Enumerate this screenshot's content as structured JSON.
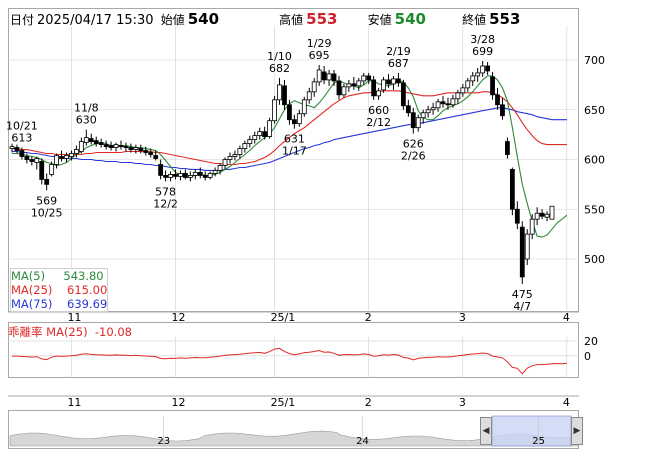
{
  "header": {
    "date_label": "日付",
    "date": "2025/04/17 15:30",
    "open_label": "始値",
    "open": "540",
    "high_label": "高値",
    "high": "553",
    "low_label": "安値",
    "low": "540",
    "close_label": "終値",
    "close": "553"
  },
  "legend": {
    "ma5_label": "MA(5)",
    "ma5_value": "543.80",
    "ma25_label": "MA(25)",
    "ma25_value": "615.00",
    "ma75_label": "MA(75)",
    "ma75_value": "639.69"
  },
  "oscillator": {
    "label": "乖離率 MA(25)",
    "value": "-10.08",
    "yticks": [
      "20",
      "0"
    ]
  },
  "colors": {
    "ma5": "#2e8b3a",
    "ma25": "#e02828",
    "ma75": "#2838d8",
    "candle": "#000000",
    "grid": "#d0d0d0",
    "nav_fill": "#c8d4f4"
  },
  "chart_data": {
    "type": "candlestick",
    "ylim": [
      450,
      720
    ],
    "yticks": [
      500,
      550,
      600,
      650,
      700
    ],
    "xticks": [
      {
        "label": "11",
        "index": 12
      },
      {
        "label": "12",
        "index": 33
      },
      {
        "label": "25/1",
        "index": 53
      },
      {
        "label": "2",
        "index": 72
      },
      {
        "label": "3",
        "index": 91
      },
      {
        "label": "4",
        "index": 112
      }
    ],
    "candles": [
      [
        611,
        616,
        607,
        613
      ],
      [
        612,
        615,
        606,
        609
      ],
      [
        609,
        612,
        600,
        603
      ],
      [
        603,
        606,
        596,
        600
      ],
      [
        600,
        603,
        594,
        598
      ],
      [
        597,
        603,
        590,
        601
      ],
      [
        598,
        601,
        575,
        580
      ],
      [
        580,
        586,
        569,
        575
      ],
      [
        585,
        598,
        583,
        595
      ],
      [
        595,
        606,
        591,
        604
      ],
      [
        603,
        609,
        598,
        601
      ],
      [
        601,
        607,
        597,
        604
      ],
      [
        603,
        609,
        599,
        606
      ],
      [
        606,
        614,
        602,
        610
      ],
      [
        608,
        622,
        606,
        618
      ],
      [
        617,
        630,
        614,
        622
      ],
      [
        621,
        626,
        615,
        618
      ],
      [
        619,
        623,
        613,
        616
      ],
      [
        617,
        621,
        612,
        615
      ],
      [
        615,
        619,
        610,
        613
      ],
      [
        614,
        618,
        609,
        612
      ],
      [
        612,
        617,
        608,
        615
      ],
      [
        614,
        619,
        610,
        613
      ],
      [
        613,
        617,
        608,
        612
      ],
      [
        612,
        616,
        607,
        610
      ],
      [
        610,
        615,
        606,
        612
      ],
      [
        611,
        615,
        606,
        609
      ],
      [
        609,
        613,
        604,
        607
      ],
      [
        607,
        611,
        602,
        605
      ],
      [
        604,
        609,
        599,
        601
      ],
      [
        595,
        600,
        580,
        584
      ],
      [
        584,
        589,
        578,
        582
      ],
      [
        582,
        588,
        578,
        585
      ],
      [
        585,
        590,
        580,
        583
      ],
      [
        583,
        589,
        579,
        586
      ],
      [
        586,
        590,
        580,
        582
      ],
      [
        582,
        588,
        578,
        584
      ],
      [
        584,
        590,
        580,
        587
      ],
      [
        587,
        592,
        581,
        584
      ],
      [
        584,
        588,
        579,
        582
      ],
      [
        582,
        588,
        580,
        586
      ],
      [
        586,
        592,
        583,
        589
      ],
      [
        589,
        596,
        585,
        594
      ],
      [
        594,
        602,
        590,
        600
      ],
      [
        600,
        607,
        596,
        603
      ],
      [
        603,
        609,
        599,
        605
      ],
      [
        605,
        614,
        601,
        611
      ],
      [
        611,
        619,
        607,
        616
      ],
      [
        616,
        624,
        612,
        620
      ],
      [
        620,
        628,
        616,
        624
      ],
      [
        624,
        632,
        620,
        628
      ],
      [
        628,
        633,
        620,
        623
      ],
      [
        623,
        642,
        621,
        639
      ],
      [
        639,
        664,
        636,
        660
      ],
      [
        660,
        682,
        655,
        675
      ],
      [
        674,
        680,
        650,
        655
      ],
      [
        655,
        660,
        635,
        640
      ],
      [
        640,
        645,
        631,
        636
      ],
      [
        636,
        650,
        633,
        646
      ],
      [
        646,
        663,
        643,
        660
      ],
      [
        660,
        672,
        656,
        668
      ],
      [
        668,
        682,
        663,
        678
      ],
      [
        678,
        695,
        674,
        690
      ],
      [
        688,
        694,
        676,
        680
      ],
      [
        680,
        690,
        674,
        686
      ],
      [
        686,
        690,
        674,
        679
      ],
      [
        679,
        684,
        660,
        665
      ],
      [
        665,
        676,
        662,
        673
      ],
      [
        673,
        680,
        668,
        676
      ],
      [
        676,
        683,
        670,
        674
      ],
      [
        674,
        682,
        669,
        679
      ],
      [
        679,
        687,
        675,
        684
      ],
      [
        684,
        687,
        676,
        680
      ],
      [
        680,
        684,
        660,
        664
      ],
      [
        664,
        672,
        660,
        669
      ],
      [
        670,
        683,
        667,
        680
      ],
      [
        680,
        686,
        672,
        676
      ],
      [
        676,
        684,
        670,
        681
      ],
      [
        681,
        687,
        673,
        677
      ],
      [
        677,
        680,
        650,
        654
      ],
      [
        654,
        660,
        643,
        647
      ],
      [
        647,
        652,
        626,
        632
      ],
      [
        632,
        645,
        628,
        642
      ],
      [
        642,
        650,
        636,
        647
      ],
      [
        647,
        654,
        642,
        650
      ],
      [
        650,
        657,
        645,
        652
      ],
      [
        652,
        661,
        648,
        658
      ],
      [
        658,
        664,
        652,
        656
      ],
      [
        656,
        662,
        650,
        655
      ],
      [
        655,
        665,
        652,
        661
      ],
      [
        661,
        670,
        656,
        667
      ],
      [
        667,
        676,
        663,
        672
      ],
      [
        672,
        682,
        668,
        679
      ],
      [
        679,
        688,
        674,
        684
      ],
      [
        684,
        692,
        678,
        687
      ],
      [
        687,
        699,
        683,
        694
      ],
      [
        694,
        698,
        685,
        689
      ],
      [
        683,
        688,
        660,
        665
      ],
      [
        665,
        672,
        650,
        655
      ],
      [
        655,
        662,
        640,
        644
      ],
      [
        618,
        622,
        601,
        605
      ],
      [
        590,
        592,
        544,
        550
      ],
      [
        550,
        558,
        530,
        536
      ],
      [
        532,
        538,
        475,
        482
      ],
      [
        500,
        530,
        494,
        525
      ],
      [
        525,
        545,
        520,
        540
      ],
      [
        540,
        552,
        534,
        546
      ],
      [
        546,
        550,
        540,
        543
      ],
      [
        542,
        548,
        538,
        545
      ],
      [
        540,
        553,
        540,
        553
      ]
    ],
    "ma5": [
      606,
      606,
      605,
      604,
      603,
      602,
      600,
      597,
      596,
      594,
      595,
      597,
      601,
      605,
      608,
      612,
      614,
      616,
      617,
      616,
      614,
      614,
      614,
      614,
      613,
      612,
      612,
      611,
      610,
      609,
      605,
      599,
      593,
      587,
      584,
      582,
      583,
      584,
      585,
      584,
      584,
      585,
      587,
      590,
      593,
      597,
      601,
      605,
      609,
      614,
      618,
      622,
      626,
      632,
      641,
      650,
      656,
      659,
      657,
      655,
      654,
      652,
      657,
      663,
      670,
      677,
      679,
      677,
      675,
      674,
      672,
      675,
      679,
      679,
      676,
      675,
      674,
      676,
      679,
      678,
      672,
      663,
      649,
      642,
      640,
      640,
      644,
      649,
      652,
      654,
      656,
      659,
      663,
      668,
      674,
      680,
      684,
      684,
      680,
      672,
      659,
      632,
      603,
      575,
      556,
      538,
      523,
      522,
      524,
      530,
      536,
      540,
      544
    ],
    "ma25": [
      611,
      611,
      610,
      610,
      609,
      608,
      607,
      606,
      606,
      605,
      605,
      605,
      605,
      605,
      605,
      606,
      606,
      607,
      607,
      607,
      607,
      607,
      607,
      608,
      608,
      608,
      608,
      608,
      608,
      607,
      607,
      606,
      605,
      604,
      603,
      602,
      601,
      600,
      599,
      598,
      597,
      596,
      596,
      595,
      595,
      595,
      596,
      596,
      597,
      598,
      600,
      602,
      605,
      609,
      614,
      618,
      622,
      626,
      629,
      632,
      636,
      640,
      644,
      648,
      652,
      656,
      659,
      662,
      664,
      665,
      666,
      667,
      667,
      668,
      668,
      669,
      669,
      669,
      669,
      668,
      667,
      666,
      665,
      664,
      664,
      664,
      665,
      666,
      667,
      667,
      667,
      667,
      667,
      667,
      667,
      668,
      668,
      667,
      665,
      662,
      658,
      652,
      645,
      637,
      630,
      624,
      619,
      616,
      615,
      615,
      615,
      615,
      615
    ],
    "ma75": [
      608,
      608,
      607,
      607,
      606,
      606,
      605,
      604,
      603,
      603,
      602,
      602,
      601,
      601,
      600,
      600,
      600,
      599,
      599,
      598,
      598,
      598,
      597,
      597,
      597,
      596,
      596,
      595,
      595,
      594,
      594,
      593,
      592,
      592,
      591,
      591,
      590,
      590,
      590,
      589,
      589,
      589,
      589,
      590,
      590,
      591,
      592,
      592,
      593,
      594,
      595,
      596,
      597,
      599,
      601,
      603,
      605,
      607,
      609,
      611,
      612,
      614,
      615,
      617,
      618,
      620,
      621,
      622,
      623,
      624,
      625,
      626,
      627,
      628,
      629,
      630,
      631,
      632,
      633,
      634,
      635,
      635,
      636,
      637,
      638,
      639,
      640,
      641,
      642,
      643,
      644,
      645,
      646,
      647,
      648,
      649,
      650,
      651,
      652,
      652,
      651,
      650,
      648,
      647,
      646,
      645,
      643,
      642,
      641,
      640,
      640,
      640,
      640
    ],
    "annotations": [
      {
        "price": "613",
        "date": "10/21",
        "index": 2,
        "dir": "up"
      },
      {
        "price": "569",
        "date": "10/25",
        "index": 7,
        "dir": "down"
      },
      {
        "price": "630",
        "date": "11/8",
        "index": 15,
        "dir": "up"
      },
      {
        "price": "578",
        "date": "12/2",
        "index": 31,
        "dir": "down"
      },
      {
        "price": "682",
        "date": "1/10",
        "index": 54,
        "dir": "up"
      },
      {
        "price": "631",
        "date": "1/17",
        "index": 57,
        "dir": "down"
      },
      {
        "price": "695",
        "date": "1/29",
        "index": 62,
        "dir": "up"
      },
      {
        "price": "660",
        "date": "2/12",
        "index": 74,
        "dir": "down"
      },
      {
        "price": "687",
        "date": "2/19",
        "index": 78,
        "dir": "up"
      },
      {
        "price": "626",
        "date": "2/26",
        "index": 81,
        "dir": "down"
      },
      {
        "price": "699",
        "date": "3/28",
        "index": 95,
        "dir": "up"
      },
      {
        "price": "475",
        "date": "4/7",
        "index": 103,
        "dir": "down"
      }
    ],
    "deviation": [
      -0.3,
      -0.4,
      -0.8,
      -1.3,
      -1.7,
      -1.2,
      -4.1,
      -5.1,
      -1.9,
      -0.2,
      -0.7,
      -0.2,
      0.2,
      0.8,
      2.1,
      2.8,
      2.0,
      1.5,
      1.3,
      1.0,
      0.8,
      1.3,
      1.0,
      0.7,
      0.3,
      0.7,
      0.2,
      -0.2,
      -0.5,
      -1.0,
      -3.6,
      -3.9,
      -3.3,
      -3.5,
      -2.8,
      -3.2,
      -2.8,
      -2.2,
      -2.5,
      -2.7,
      -1.8,
      -1.2,
      -0.3,
      0.8,
      1.3,
      1.7,
      2.2,
      3.0,
      3.7,
      4.3,
      4.7,
      3.5,
      5.8,
      9.2,
      10.1,
      6.0,
      3.1,
      1.6,
      2.7,
      4.4,
      5.0,
      5.9,
      7.2,
      4.9,
      5.2,
      3.5,
      0.9,
      1.7,
      1.8,
      1.3,
      1.7,
      2.5,
      1.9,
      -0.6,
      0.1,
      1.6,
      1.0,
      1.8,
      1.2,
      -2.1,
      -3.0,
      -5.4,
      -3.5,
      -2.6,
      -2.1,
      -1.8,
      -1.1,
      -1.5,
      -1.6,
      -0.9,
      0.0,
      0.8,
      1.8,
      2.5,
      2.9,
      3.9,
      3.1,
      -0.3,
      -1.5,
      -2.7,
      -8.1,
      -15.6,
      -16.9,
      -24.3,
      -16.7,
      -13.5,
      -11.8,
      -11.8,
      -11.4,
      -10.8,
      -10.3,
      -10.6,
      -10.1
    ],
    "deviation_ylim": [
      -30,
      35
    ],
    "navigator": {
      "labels": [
        {
          "text": "23",
          "pos": 0.27
        },
        {
          "text": "24",
          "pos": 0.62
        },
        {
          "text": "25",
          "pos": 0.93
        }
      ]
    }
  }
}
